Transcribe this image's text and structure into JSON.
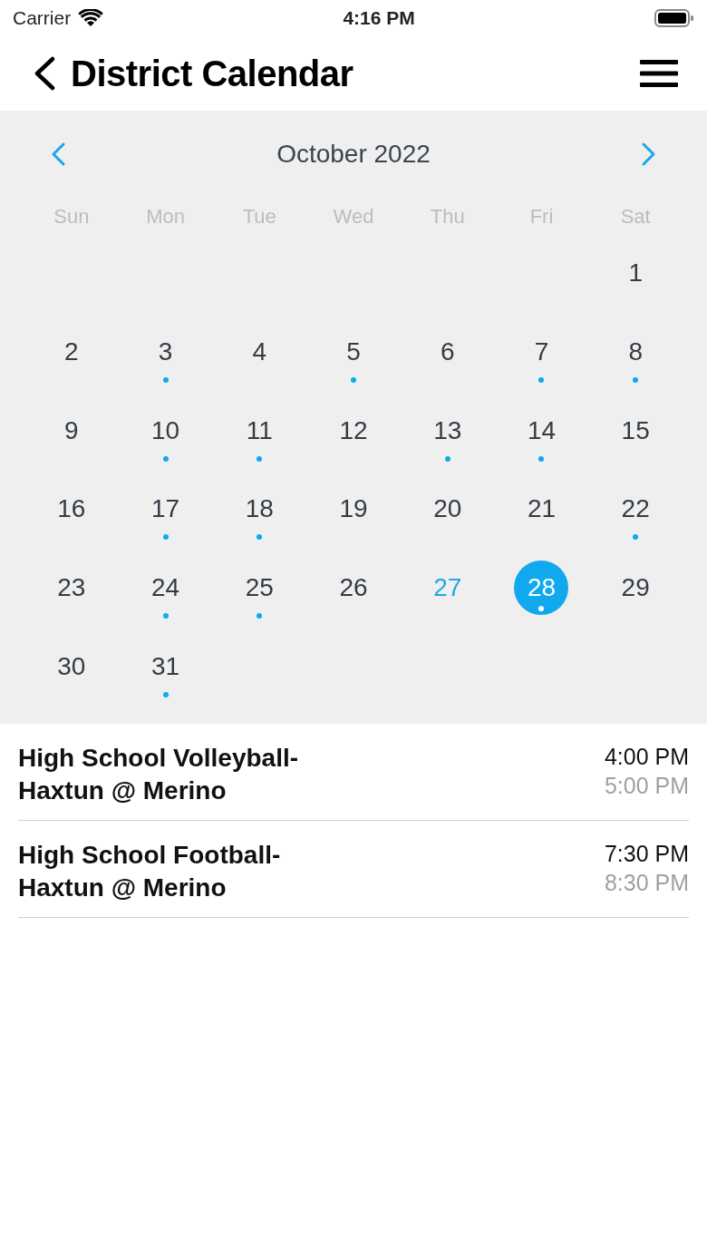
{
  "status_bar": {
    "carrier": "Carrier",
    "time": "4:16 PM"
  },
  "header": {
    "title": "District Calendar"
  },
  "calendar": {
    "month": "October 2022",
    "weekdays": [
      "Sun",
      "Mon",
      "Tue",
      "Wed",
      "Thu",
      "Fri",
      "Sat"
    ],
    "weeks": [
      [
        {
          "kind": "blank"
        },
        {
          "kind": "blank"
        },
        {
          "kind": "blank"
        },
        {
          "kind": "blank"
        },
        {
          "kind": "blank"
        },
        {
          "kind": "blank"
        },
        {
          "kind": "day",
          "day": "1",
          "event": false,
          "today": false,
          "selected": false
        }
      ],
      [
        {
          "day": "2",
          "event": false,
          "today": false,
          "selected": false
        },
        {
          "day": "3",
          "event": true,
          "today": false,
          "selected": false
        },
        {
          "day": "4",
          "event": false,
          "today": false,
          "selected": false
        },
        {
          "day": "5",
          "event": true,
          "today": false,
          "selected": false
        },
        {
          "day": "6",
          "event": false,
          "today": false,
          "selected": false
        },
        {
          "day": "7",
          "event": true,
          "today": false,
          "selected": false
        },
        {
          "day": "8",
          "event": true,
          "today": false,
          "selected": false
        }
      ],
      [
        {
          "day": "9",
          "event": false,
          "today": false,
          "selected": false
        },
        {
          "day": "10",
          "event": true,
          "today": false,
          "selected": false
        },
        {
          "day": "11",
          "event": true,
          "today": false,
          "selected": false
        },
        {
          "day": "12",
          "event": false,
          "today": false,
          "selected": false
        },
        {
          "day": "13",
          "event": true,
          "today": false,
          "selected": false
        },
        {
          "day": "14",
          "event": true,
          "today": false,
          "selected": false
        },
        {
          "day": "15",
          "event": false,
          "today": false,
          "selected": false
        }
      ],
      [
        {
          "day": "16",
          "event": false,
          "today": false,
          "selected": false
        },
        {
          "day": "17",
          "event": true,
          "today": false,
          "selected": false
        },
        {
          "day": "18",
          "event": true,
          "today": false,
          "selected": false
        },
        {
          "day": "19",
          "event": false,
          "today": false,
          "selected": false
        },
        {
          "day": "20",
          "event": false,
          "today": false,
          "selected": false
        },
        {
          "day": "21",
          "event": false,
          "today": false,
          "selected": false
        },
        {
          "day": "22",
          "event": true,
          "today": false,
          "selected": false
        }
      ],
      [
        {
          "day": "23",
          "event": false,
          "today": false,
          "selected": false
        },
        {
          "day": "24",
          "event": true,
          "today": false,
          "selected": false
        },
        {
          "day": "25",
          "event": true,
          "today": false,
          "selected": false
        },
        {
          "day": "26",
          "event": false,
          "today": false,
          "selected": false
        },
        {
          "day": "27",
          "event": false,
          "today": true,
          "selected": false
        },
        {
          "day": "28",
          "event": true,
          "today": false,
          "selected": true
        },
        {
          "day": "29",
          "event": false,
          "today": false,
          "selected": false
        }
      ],
      [
        {
          "day": "30",
          "event": false,
          "today": false,
          "selected": false
        },
        {
          "day": "31",
          "event": true,
          "today": false,
          "selected": false
        },
        {
          "kind": "blank"
        },
        {
          "kind": "blank"
        },
        {
          "kind": "blank"
        },
        {
          "kind": "blank"
        },
        {
          "kind": "blank"
        }
      ]
    ]
  },
  "events": [
    {
      "title": "High School Volleyball- Haxtun @ Merino",
      "start": "4:00 PM",
      "end": "5:00 PM"
    },
    {
      "title": "High School Football- Haxtun @ Merino",
      "start": "7:30 PM",
      "end": "8:30 PM"
    }
  ]
}
